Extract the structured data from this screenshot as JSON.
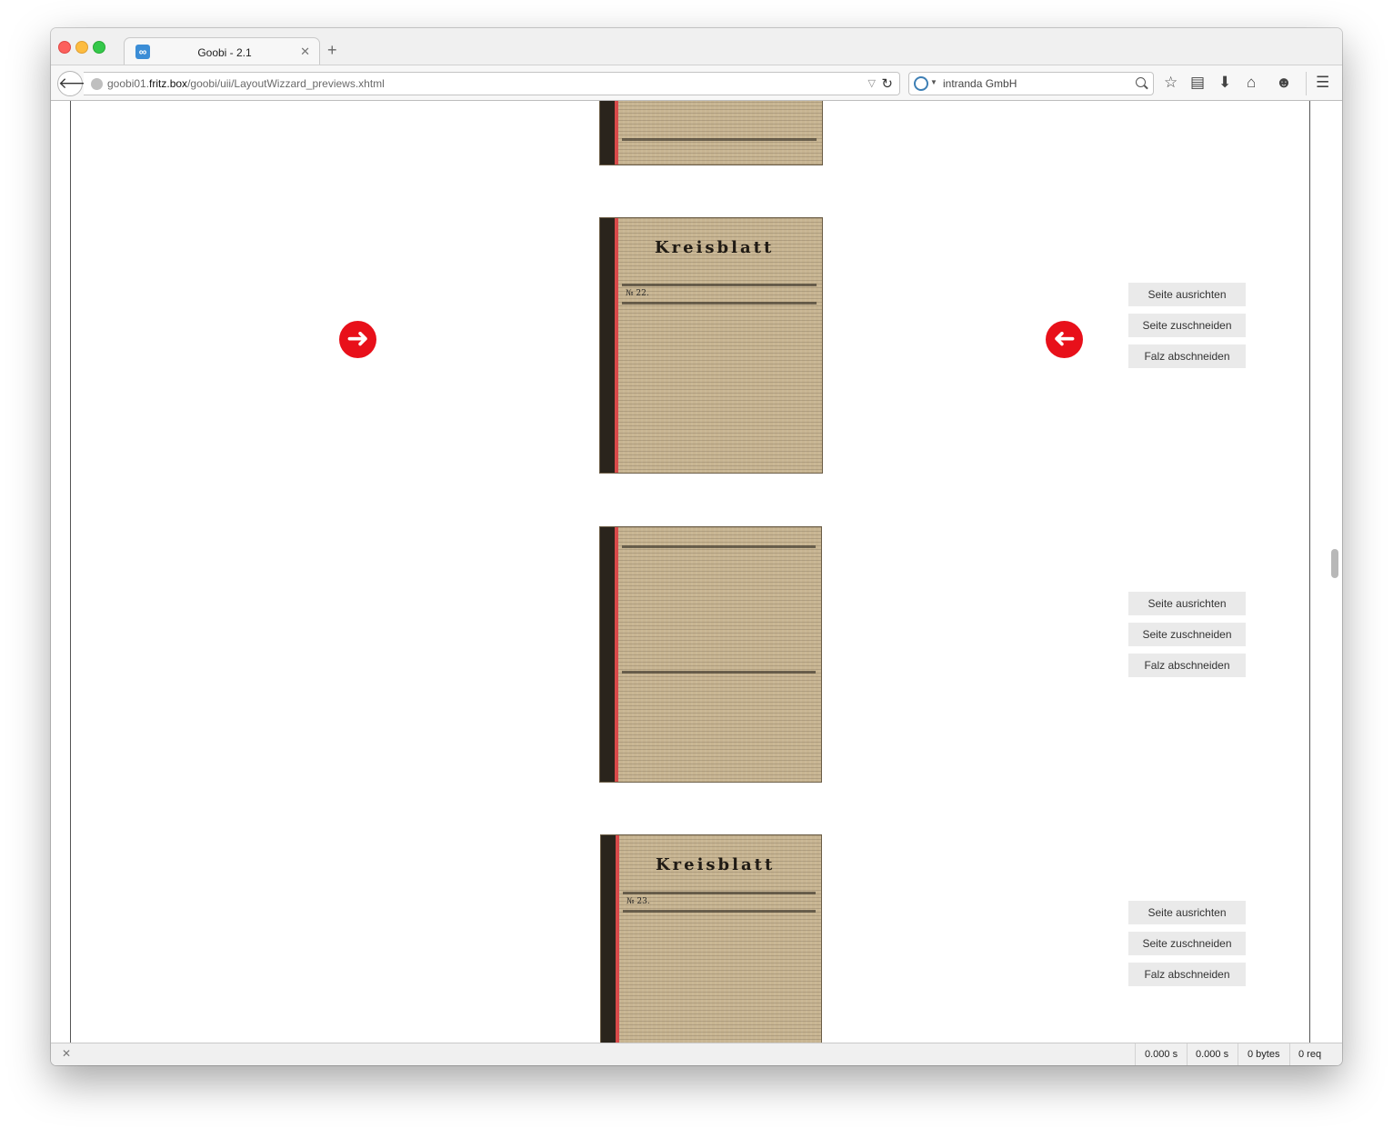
{
  "browser": {
    "tab": {
      "title": "Goobi - 2.1",
      "favicon_icon": "goobi-infinity-icon"
    },
    "address": {
      "prefix": "goobi01.",
      "host": "fritz.box",
      "path": "/goobi/uii/LayoutWizzard_previews.xhtml"
    },
    "search": {
      "engine_icon": "intranda-search-engine-icon",
      "value": "intranda GmbH"
    }
  },
  "content": {
    "pages": [
      {
        "masthead": "",
        "number": ""
      },
      {
        "masthead": "Kreisblatt",
        "number": "№ 22."
      },
      {
        "masthead": "",
        "number": ""
      },
      {
        "masthead": "Kreisblatt",
        "number": "№ 23."
      }
    ],
    "actions": {
      "align_label": "Seite ausrichten",
      "crop_label": "Seite zuschneiden",
      "fold_label": "Falz abschneiden"
    },
    "arrows": {
      "right_icon": "arrow-right-circle-icon",
      "left_icon": "arrow-left-circle-icon",
      "accent": "#e8101a"
    }
  },
  "statusbar": {
    "time1": "0.000 s",
    "time2": "0.000 s",
    "bytes": "0 bytes",
    "requests": "0 req"
  }
}
